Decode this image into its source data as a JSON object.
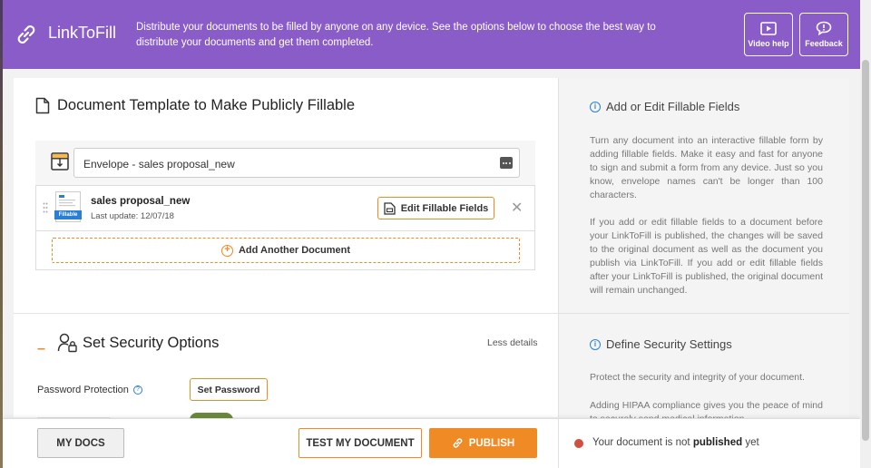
{
  "header": {
    "title": "LinkToFill",
    "description": "Distribute your documents to be filled by anyone on any device. See the options below to choose the best way to distribute your documents and get them completed.",
    "video_help_label": "Video help",
    "feedback_label": "Feedback"
  },
  "template_section": {
    "title": "Document Template to Make Publicly Fillable",
    "envelope_name": "Envelope - sales proposal_new",
    "document": {
      "name": "sales proposal_new",
      "last_update": "Last update: 12/07/18",
      "badge": "Fillable"
    },
    "edit_button_label": "Edit Fillable Fields",
    "close_symbol": "✕",
    "add_document_label": "Add Another Document"
  },
  "info_fillable": {
    "title": "Add or Edit Fillable Fields",
    "paragraph1": "Turn any document into an interactive fillable form by adding fillable fields. Make it easy and fast for anyone to sign and submit a form from any device. Just so you know, envelope names can't be longer than 100 characters.",
    "paragraph2": "If you add or edit fillable fields to a document before your LinkToFill is published, the changes will be saved to the original document as well as the document you publish via LinkToFill. If you add or edit fillable fields after your LinkToFill is published, the original document will remain unchanged."
  },
  "security_section": {
    "collapse_symbol": "–",
    "title": "Set Security Options",
    "less_details_label": "Less details",
    "password_label": "Password Protection",
    "help_symbol": "?",
    "set_password_label": "Set Password"
  },
  "info_security": {
    "title": "Define Security Settings",
    "paragraph1": "Protect the security and integrity of your document.",
    "paragraph2": "Adding HIPAA compliance gives you the peace of mind to securely send medical information."
  },
  "footer": {
    "my_docs_label": "MY DOCS",
    "test_label": "TEST MY DOCUMENT",
    "publish_label": "PUBLISH",
    "status_prefix": "Your document is not ",
    "status_bold": "published",
    "status_suffix": " yet"
  },
  "colors": {
    "header_purple": "#8a5cc8",
    "accent_orange": "#f08a24",
    "info_blue": "#2a7fd4",
    "status_red": "#d05040"
  }
}
